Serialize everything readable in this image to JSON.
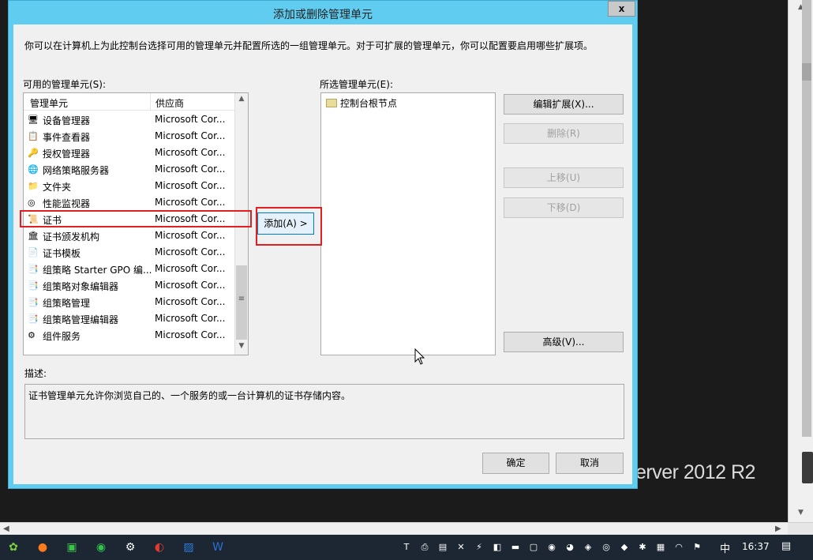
{
  "dialog": {
    "title": "添加或删除管理单元",
    "close_label": "x",
    "intro": "你可以在计算机上为此控制台选择可用的管理单元并配置所选的一组管理单元。对于可扩展的管理单元，你可以配置要启用哪些扩展项。",
    "available_label": "可用的管理单元(S):",
    "selected_label": "所选管理单元(E):",
    "columns": {
      "name": "管理单元",
      "vendor": "供应商"
    },
    "snapins": [
      {
        "name": "设备管理器",
        "vendor": "Microsoft Cor...",
        "icon": "device-manager-icon"
      },
      {
        "name": "事件查看器",
        "vendor": "Microsoft Cor...",
        "icon": "event-viewer-icon"
      },
      {
        "name": "授权管理器",
        "vendor": "Microsoft Cor...",
        "icon": "authorization-manager-icon"
      },
      {
        "name": "网络策略服务器",
        "vendor": "Microsoft Cor...",
        "icon": "network-policy-server-icon"
      },
      {
        "name": "文件夹",
        "vendor": "Microsoft Cor...",
        "icon": "folder-icon"
      },
      {
        "name": "性能监视器",
        "vendor": "Microsoft Cor...",
        "icon": "performance-monitor-icon"
      },
      {
        "name": "证书",
        "vendor": "Microsoft Cor...",
        "icon": "certificate-icon"
      },
      {
        "name": "证书颁发机构",
        "vendor": "Microsoft Cor...",
        "icon": "certificate-authority-icon"
      },
      {
        "name": "证书模板",
        "vendor": "Microsoft Cor...",
        "icon": "certificate-template-icon"
      },
      {
        "name": "组策略 Starter GPO 编...",
        "vendor": "Microsoft Cor...",
        "icon": "gpo-editor-icon"
      },
      {
        "name": "组策略对象编辑器",
        "vendor": "Microsoft Cor...",
        "icon": "gpo-object-editor-icon"
      },
      {
        "name": "组策略管理",
        "vendor": "Microsoft Cor...",
        "icon": "gpo-management-icon"
      },
      {
        "name": "组策略管理编辑器",
        "vendor": "Microsoft Cor...",
        "icon": "gpo-management-editor-icon"
      },
      {
        "name": "组件服务",
        "vendor": "Microsoft Cor...",
        "icon": "component-services-icon"
      }
    ],
    "selected_root": "控制台根节点",
    "buttons": {
      "add": "添加(A) >",
      "edit_extensions": "编辑扩展(X)...",
      "remove": "删除(R)",
      "move_up": "上移(U)",
      "move_down": "下移(D)",
      "advanced": "高级(V)...",
      "ok": "确定",
      "cancel": "取消"
    },
    "description_label": "描述:",
    "description": "证书管理单元允许你浏览自己的、一个服务的或一台计算机的证书存储内容。"
  },
  "desktop": {
    "brand_text": "erver 2012 R2"
  },
  "taskbar": {
    "clock": "16:37",
    "ime": "中",
    "apps": [
      "start-icon",
      "firefox-icon",
      "app-green-icon",
      "wechat-work-icon",
      "settings-icon",
      "browser-icon",
      "photos-icon",
      "word-icon"
    ],
    "tray": [
      "tb-icon",
      "printer-icon",
      "network-drive-icon",
      "mute-icon",
      "defender-icon",
      "security-icon",
      "power-icon",
      "screen-icon",
      "chat-icon",
      "qq-icon",
      "color-icon",
      "wechat-icon",
      "shield-icon",
      "bluetooth-icon",
      "notes-icon",
      "wifi-icon",
      "flag-icon"
    ]
  },
  "colors": {
    "highlight": "#e02020",
    "dialog_frame": "#60cdf0",
    "taskbar": "#1c2733"
  }
}
